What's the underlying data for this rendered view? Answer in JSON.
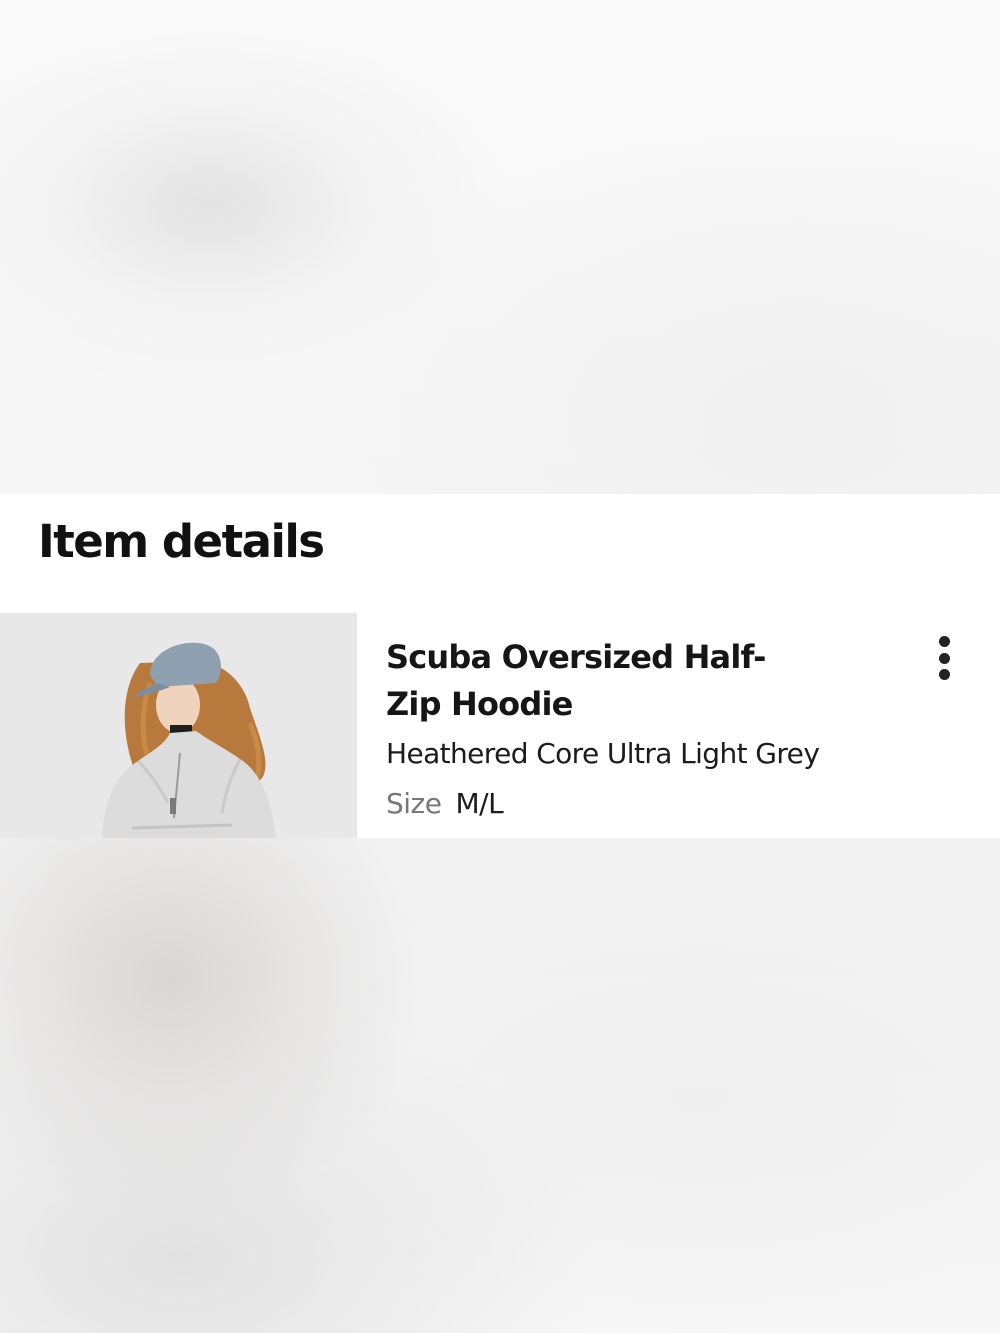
{
  "item_details": {
    "title": "Item details",
    "product": {
      "name": "Scuba Oversized Half-Zip Hoodie",
      "color": "Heathered Core Ultra Light Grey",
      "size_label": "Size",
      "size_value": "M/L"
    },
    "icons": {
      "more": "more-vertical-icon"
    }
  }
}
